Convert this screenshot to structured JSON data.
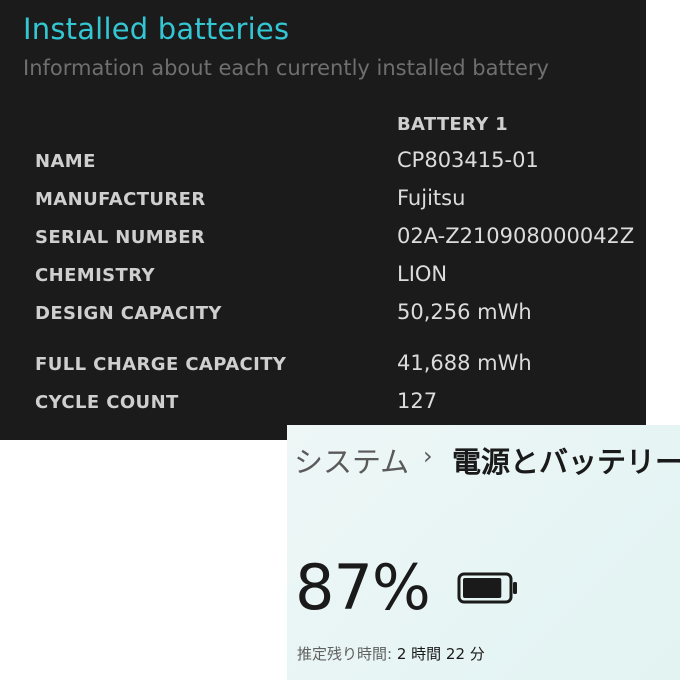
{
  "report": {
    "title": "Installed batteries",
    "subtitle": "Information about each currently installed battery",
    "column_header": "BATTERY 1",
    "rows": [
      {
        "label": "NAME",
        "value": "CP803415-01"
      },
      {
        "label": "MANUFACTURER",
        "value": "Fujitsu"
      },
      {
        "label": "SERIAL NUMBER",
        "value": "02A-Z210908000042Z"
      },
      {
        "label": "CHEMISTRY",
        "value": "LION"
      },
      {
        "label": "DESIGN CAPACITY",
        "value": "50,256 mWh"
      },
      {
        "label": "FULL CHARGE CAPACITY",
        "value": "41,688 mWh"
      },
      {
        "label": "CYCLE COUNT",
        "value": "127"
      }
    ]
  },
  "settings": {
    "breadcrumb_parent": "システム",
    "breadcrumb_separator": "›",
    "breadcrumb_current": "電源とバッテリー",
    "battery_percent": "87%",
    "battery_level": 0.87,
    "battery_icon": "battery-icon",
    "remaining_label": "推定残り時間:",
    "remaining_value": "2 時間 22 分"
  },
  "colors": {
    "report_background": "#1b1b1b",
    "report_title": "#33c6d3",
    "settings_background": "#e6f5f4"
  }
}
